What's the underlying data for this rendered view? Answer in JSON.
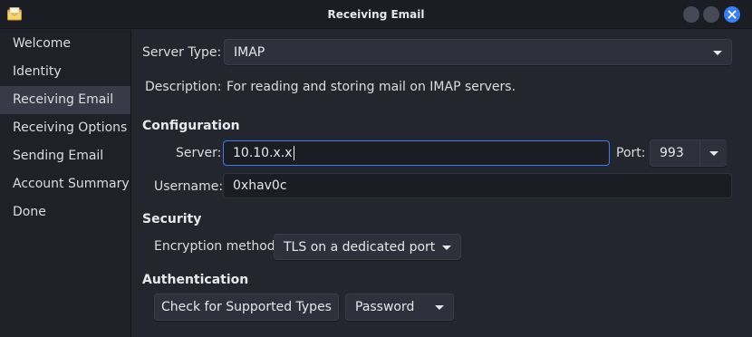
{
  "window": {
    "title": "Receiving Email"
  },
  "sidebar": {
    "items": [
      {
        "label": "Welcome"
      },
      {
        "label": "Identity"
      },
      {
        "label": "Receiving Email",
        "active": true
      },
      {
        "label": "Receiving Options"
      },
      {
        "label": "Sending Email"
      },
      {
        "label": "Account Summary"
      },
      {
        "label": "Done"
      }
    ]
  },
  "main": {
    "server_type_label": "Server Type:",
    "server_type_value": "IMAP",
    "description_label": "Description:",
    "description_value": "For reading and storing mail on IMAP servers.",
    "configuration_heading": "Configuration",
    "server_label": "Server:",
    "server_value": "10.10.x.x",
    "port_label": "Port:",
    "port_value": "993",
    "username_label": "Username:",
    "username_value": "0xhav0c",
    "security_heading": "Security",
    "encryption_label": "Encryption method:",
    "encryption_value": "TLS on a dedicated port",
    "authentication_heading": "Authentication",
    "check_types_button": "Check for Supported Types",
    "auth_method_value": "Password"
  },
  "colors": {
    "accent": "#3a7ff2",
    "background": "#24262f",
    "sidebar_bg": "#1f2028",
    "sidebar_active": "#383a47"
  },
  "icons": {
    "app": "mail-envelope-icon",
    "close": "close-icon"
  }
}
